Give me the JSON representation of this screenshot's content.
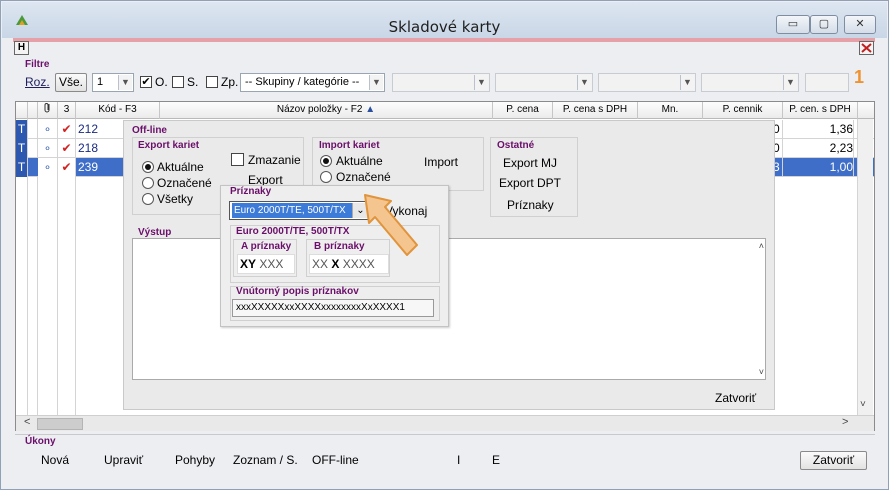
{
  "window": {
    "title": "Skladové karty",
    "minimize": "▭",
    "maximize": "▢",
    "close": "✕"
  },
  "h_button": "H",
  "filters": {
    "label": "Filtre",
    "roz": "Roz.",
    "vse": "Vše.",
    "count_value": "1",
    "o_label": "O.",
    "s_label": "S.",
    "zp_label": "Zp.",
    "skupiny": "-- Skupiny / kategórie --",
    "badge": "1"
  },
  "grid": {
    "headers": {
      "col3": "3",
      "kod": "Kód - F3",
      "nazov": "Názov položky - F2",
      "sort": "▲",
      "pcena": "P. cena",
      "pcena_dph": "P. cena s DPH",
      "mn": "Mn.",
      "pcennik": "P. cennik",
      "pcen_dph": "P. cen. s DPH"
    },
    "rows": [
      {
        "flag": "T",
        "dot": "∘",
        "check": "✔",
        "kod": "212",
        "pcen_tail": "0",
        "pcen_dph": "1,36"
      },
      {
        "flag": "T",
        "dot": "∘",
        "check": "✔",
        "kod": "218",
        "pcen_tail": "0",
        "pcen_dph": "2,23"
      },
      {
        "flag": "T",
        "dot": "∘",
        "check": "✔",
        "kod": "239",
        "pcen_tail": "3",
        "pcen_dph": "1,00"
      }
    ],
    "scroll_left": "<",
    "scroll_right": ">",
    "scroll_up": "˄",
    "scroll_down": "˅"
  },
  "offline": {
    "title": "Off-line",
    "export": {
      "title": "Export kariet",
      "aktualne": "Aktuálne",
      "oznacene": "Označené",
      "vsetky": "Všetky",
      "zmazanie": "Zmazanie",
      "export_btn": "Export"
    },
    "import": {
      "title": "Import kariet",
      "aktualne": "Aktuálne",
      "oznacene": "Označené",
      "import_btn": "Import"
    },
    "ostatne": {
      "title": "Ostatné",
      "export_mj": "Export MJ",
      "export_dpt": "Export DPT",
      "priznaky": "Príznaky"
    },
    "vystup": "Výstup",
    "zatvorit": "Zatvoriť"
  },
  "priznaky_popup": {
    "title": "Príznaky",
    "selected": "Euro 2000T/TE, 500T/TX",
    "vykonaj": "Vykonaj",
    "group_title": "Euro 2000T/TE, 500T/TX",
    "a_title": "A príznaky",
    "a_bold": "XY",
    "a_value": "XXX",
    "b_title": "B príznaky",
    "b_prefix": "XX",
    "b_bold": "X",
    "b_value": "XXXX",
    "vnutorny_title": "Vnútorný popis príznakov",
    "vnutorny_value": "xxxXXXXXxxXXXXxxxxxxxxXxXXXX1"
  },
  "ukony": {
    "label": "Úkony",
    "nova": "Nová",
    "upravit": "Upraviť",
    "pohyby": "Pohyby",
    "zoznam": "Zoznam / S.",
    "offline": "OFF-line",
    "i": "I",
    "e": "E",
    "zatvorit": "Zatvoriť"
  },
  "colors": {
    "accent": "#f0922f",
    "selection": "#3f6ec8",
    "group_title": "#6a0f6a",
    "check": "#d42020"
  }
}
